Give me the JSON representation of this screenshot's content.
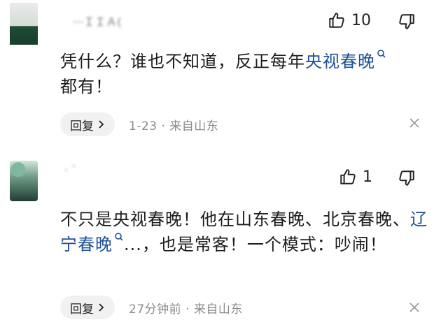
{
  "comments": [
    {
      "username": "···ＩＩＡ(",
      "likes": "10",
      "text_before": "凭什么？谁也不知道，反正每年",
      "link_text": "央视春晚",
      "text_after": "都有！",
      "reply_label": "回复",
      "meta": "1-23 · 来自山东"
    },
    {
      "username": "· `",
      "likes": "1",
      "text_before": "不只是央视春晚！他在山东春晚、北京春晚、",
      "link_text": "辽宁春晚",
      "text_after": "...，也是常客！一个模式：吵闹！",
      "reply_label": "回复",
      "meta": "27分钟前 · 来自山东"
    }
  ],
  "colors": {
    "link": "#1f4f96",
    "meta": "#8b8b8b",
    "reply_bg": "#f1f1f1"
  },
  "icons": [
    "thumbs-up-icon",
    "thumbs-down-icon",
    "search-icon",
    "chevron-right-icon",
    "close-icon"
  ]
}
